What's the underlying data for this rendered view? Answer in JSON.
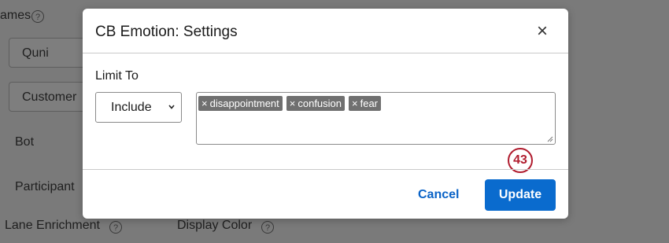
{
  "background": {
    "names_label": "ames",
    "buttons": [
      "Quni",
      "Customer"
    ],
    "labels": [
      "Bot",
      "Participant"
    ],
    "lane_enrichment_label": "Lane Enrichment",
    "display_color_label": "Display Color",
    "help_glyph": "?"
  },
  "modal": {
    "title": "CB Emotion: Settings",
    "close_glyph": "×",
    "limit_to_label": "Limit To",
    "select_value": "Include",
    "tags": [
      {
        "remove": "×",
        "label": "disappointment"
      },
      {
        "remove": "×",
        "label": "confusion"
      },
      {
        "remove": "×",
        "label": "fear"
      }
    ],
    "step_badge": "43",
    "cancel_label": "Cancel",
    "update_label": "Update"
  },
  "colors": {
    "overlay": "#7a7a7a",
    "primary": "#0a6bce",
    "link": "#0a63c7",
    "badge": "#b01c2e",
    "tag": "#707070"
  }
}
